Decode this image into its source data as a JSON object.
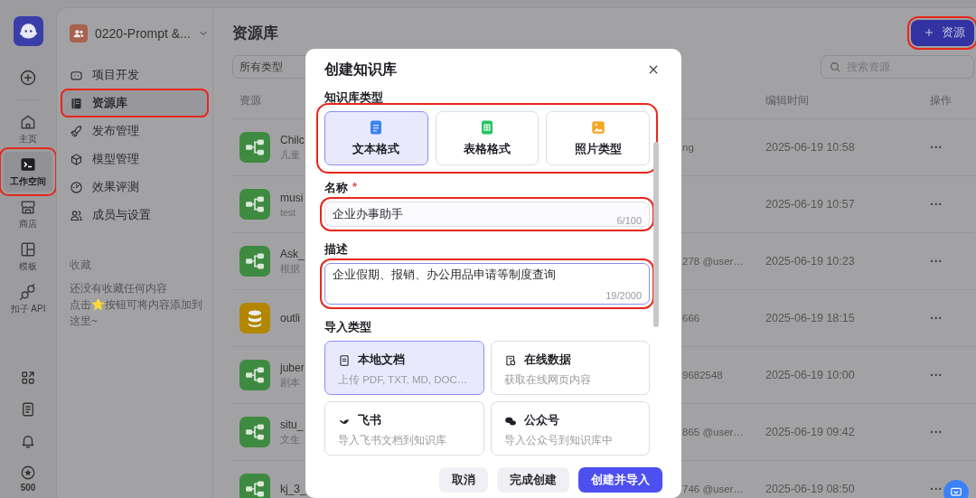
{
  "rail": {
    "items": [
      {
        "label": "主页",
        "selected": false,
        "highlighted": false
      },
      {
        "label": "工作空间",
        "selected": true,
        "highlighted": true
      },
      {
        "label": "商店",
        "selected": false,
        "highlighted": false
      },
      {
        "label": "模板",
        "selected": false,
        "highlighted": false
      },
      {
        "label": "扣子 API",
        "selected": false,
        "highlighted": false
      }
    ],
    "points": "500"
  },
  "workspace": {
    "name": "0220-Prompt &..."
  },
  "nav": {
    "items": [
      {
        "label": "项目开发",
        "selected": false,
        "highlighted": false
      },
      {
        "label": "资源库",
        "selected": true,
        "highlighted": true
      },
      {
        "label": "发布管理",
        "selected": false,
        "highlighted": false
      },
      {
        "label": "模型管理",
        "selected": false,
        "highlighted": false
      },
      {
        "label": "效果评测",
        "selected": false,
        "highlighted": false
      },
      {
        "label": "成员与设置",
        "selected": false,
        "highlighted": false
      }
    ]
  },
  "favorites": {
    "title": "收藏",
    "lines": [
      "还没有收藏任何内容",
      "点击⭐按钮可将内容添加到这里~"
    ]
  },
  "main": {
    "title": "资源库",
    "add_button": {
      "label": "资源",
      "highlighted": true
    },
    "filter": {
      "value": "所有类型"
    },
    "search": {
      "placeholder": "搜索资源"
    },
    "table": {
      "columns": [
        "资源",
        "编辑时间",
        "操作"
      ],
      "rows": [
        {
          "kind": "workflow",
          "name": "Chilc",
          "desc": "儿童",
          "owner": "ng",
          "time": "2025-06-19 10:58",
          "action": "···"
        },
        {
          "kind": "workflow",
          "name": "musi",
          "desc": "test",
          "time": "2025-06-19 10:57",
          "action": "···"
        },
        {
          "kind": "workflow",
          "name": "Ask_",
          "desc": "根据",
          "owner": "278 @user…",
          "time": "2025-06-19 10:23",
          "action": "···"
        },
        {
          "kind": "database",
          "name": "outli",
          "owner": "666",
          "time": "2025-06-19 18:15",
          "action": "···"
        },
        {
          "kind": "workflow",
          "name": "juber",
          "desc": "剧本",
          "owner": "9682548",
          "time": "2025-06-19 10:00",
          "action": "···"
        },
        {
          "kind": "workflow",
          "name": "situ_",
          "desc": "文生",
          "owner": "865 @user…",
          "time": "2025-06-19 09:42",
          "action": "···"
        },
        {
          "kind": "workflow",
          "name": "kj_3_",
          "owner": "746 @user…",
          "time": "2025-06-19 08:50",
          "action": "···"
        }
      ]
    }
  },
  "modal": {
    "title": "创建知识库",
    "type_label": "知识库类型",
    "types_highlighted": true,
    "types": [
      {
        "label": "文本格式",
        "selected": true
      },
      {
        "label": "表格格式",
        "selected": false
      },
      {
        "label": "照片类型",
        "selected": false
      }
    ],
    "name": {
      "label": "名称",
      "required_mark": "*",
      "value": "企业办事助手",
      "counter": "6/100",
      "highlighted": true
    },
    "description": {
      "label": "描述",
      "value": "企业假期、报销、办公用品申请等制度查询",
      "counter": "19/2000",
      "focused": true,
      "highlighted": true
    },
    "import_label": "导入类型",
    "import_types": [
      {
        "title": "本地文档",
        "subtitle": "上传 PDF, TXT, MD, DOC…",
        "selected": true
      },
      {
        "title": "在线数据",
        "subtitle": "获取在线网页内容",
        "selected": false
      },
      {
        "title": "飞书",
        "subtitle": "导入飞书文档到知识库",
        "selected": false
      },
      {
        "title": "公众号",
        "subtitle": "导入公众号到知识库中",
        "selected": false
      }
    ],
    "buttons": [
      {
        "label": "取消",
        "kind": "secondary"
      },
      {
        "label": "完成创建",
        "kind": "secondary"
      },
      {
        "label": "创建并导入",
        "kind": "primary"
      }
    ]
  }
}
